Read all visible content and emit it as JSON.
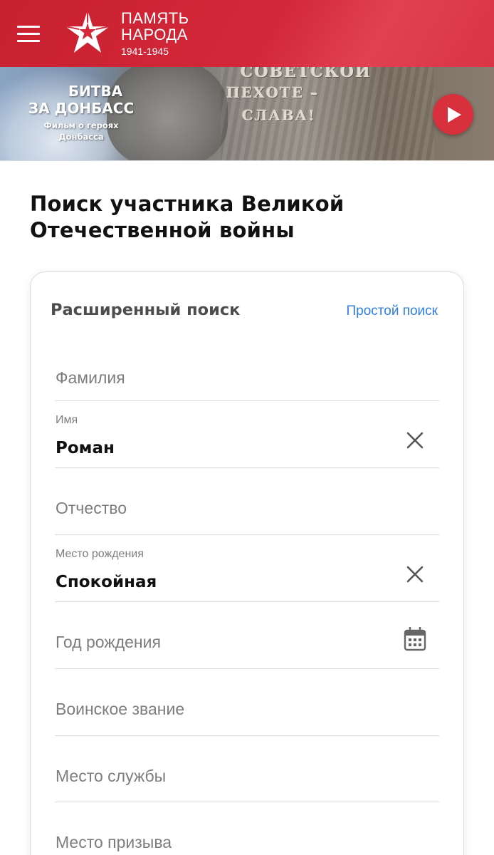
{
  "header": {
    "logo_line1": "ПАМЯТЬ",
    "logo_line2": "НАРОДА",
    "logo_years": "1941-1945",
    "menu_icon": "hamburger-menu-icon",
    "logo_icon": "star-logo-icon",
    "brand_color": "#d3283a"
  },
  "banner": {
    "title_line1": "БИТВА",
    "title_line2": "ЗА ДОНБАСС",
    "subtitle": "Фильм о героях Донбасса",
    "engraving_line1": "СОВЕТСКОЙ",
    "engraving_line2": "ПЕХОТЕ –",
    "engraving_line3": "СЛАВА!",
    "play_icon": "play-icon",
    "play_color": "#d9303d"
  },
  "page": {
    "title": "Поиск участника Великой Отечественной войны"
  },
  "search_form": {
    "title": "Расширенный поиск",
    "switch_link": "Простой поиск",
    "link_color": "#2f7de1",
    "fields": [
      {
        "placeholder": "Фамилия"
      },
      {
        "label": "Имя",
        "value": "Роман",
        "clear_icon": "close-icon"
      },
      {
        "placeholder": "Отчество"
      },
      {
        "label": "Место рождения",
        "value": "Спокойная",
        "clear_icon": "close-icon"
      },
      {
        "placeholder": "Год рождения",
        "icon": "calendar-icon"
      },
      {
        "placeholder": "Воинское звание"
      },
      {
        "placeholder": "Место службы"
      },
      {
        "placeholder": "Место призыва"
      }
    ]
  }
}
